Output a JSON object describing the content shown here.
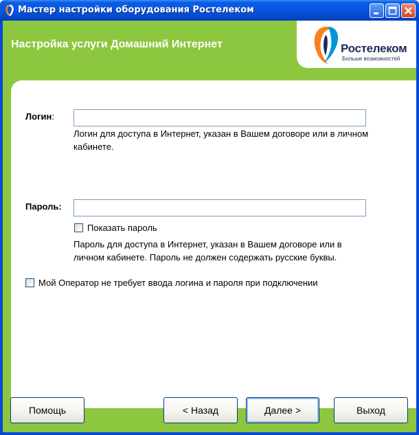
{
  "window": {
    "title": "Мастер настройки оборудования Ростелеком",
    "controls": [
      "minimize-icon",
      "maximize-icon",
      "close-icon"
    ]
  },
  "header": {
    "title": "Настройка услуги Домашний Интернет",
    "logo": {
      "name": "Ростелеком",
      "tagline": "Больше возможностей"
    }
  },
  "form": {
    "login": {
      "label": "Логин",
      "colon": ":",
      "value": "",
      "help": "Логин для доступа в Интернет, указан в Вашем договоре или в личном кабинете."
    },
    "password": {
      "label": "Пароль:",
      "value": "",
      "show_password_label": "Показать пароль",
      "show_password_checked": false,
      "help": "Пароль для доступа в Интернет, указан в Вашем договоре или в личном кабинете. Пароль не должен содержать русские буквы."
    },
    "no_auth": {
      "label": "Мой Оператор не требует ввода логина и пароля при подключении",
      "checked": false
    }
  },
  "buttons": {
    "help": "Помощь",
    "back": "< Назад",
    "next": "Далее >",
    "exit": "Выход"
  },
  "colors": {
    "titlebar": "#0655e0",
    "accent_green": "#8dc63f",
    "brand_navy": "#1b2a5b",
    "brand_orange": "#f58220",
    "brand_blue": "#0097d7"
  }
}
